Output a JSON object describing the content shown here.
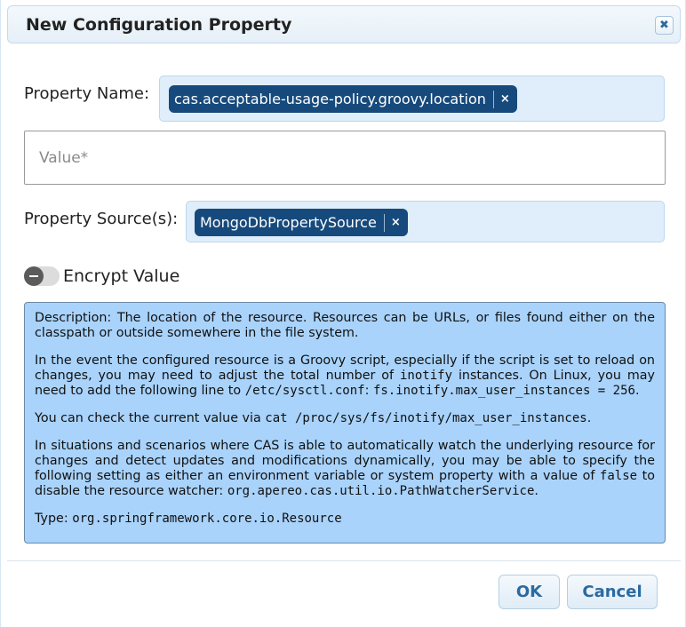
{
  "dialog": {
    "title": "New Configuration Property",
    "close_glyph": "✖"
  },
  "property_name": {
    "label": "Property Name:",
    "chip": "cas.acceptable-usage-policy.groovy.location",
    "chip_remove_glyph": "×"
  },
  "value": {
    "placeholder": "Value*",
    "current": ""
  },
  "property_source": {
    "label": "Property Source(s):",
    "chip": "MongoDbPropertySource",
    "chip_remove_glyph": "×"
  },
  "encrypt": {
    "label": "Encrypt Value",
    "enabled": false
  },
  "description": {
    "p1": "Description: The location of the resource. Resources can be URLs, or files found either on the classpath or outside somewhere in the file system.",
    "p2_a": "In the event the configured resource is a Groovy script, especially if the script is set to reload on changes, you may need to adjust the total number of ",
    "p2_code1": "inotify",
    "p2_b": " instances. On Linux, you may need to add the following line to ",
    "p2_code2": "/etc/sysctl.conf",
    "p2_c": ": ",
    "p2_code3": "fs.inotify.max_user_instances = 256",
    "p2_d": ".",
    "p3_a": "You can check the current value via ",
    "p3_code": "cat /proc/sys/fs/inotify/max_user_instances",
    "p3_b": ".",
    "p4_a": "In situations and scenarios where CAS is able to automatically watch the underlying resource for changes and detect updates and modifications dynamically, you may be able to specify the following setting as either an environment variable or system property with a value of ",
    "p4_code1": "false",
    "p4_b": " to disable the resource watcher: ",
    "p4_code2": "org.apereo.cas.util.io.PathWatcherService",
    "p4_c": ".",
    "type_label": "Type: ",
    "type_value": "org.springframework.core.io.Resource"
  },
  "buttons": {
    "ok": "OK",
    "cancel": "Cancel"
  },
  "colors": {
    "chip_bg": "#174a7c",
    "description_bg": "#a9d3fb",
    "button_text": "#2b6aa0"
  }
}
